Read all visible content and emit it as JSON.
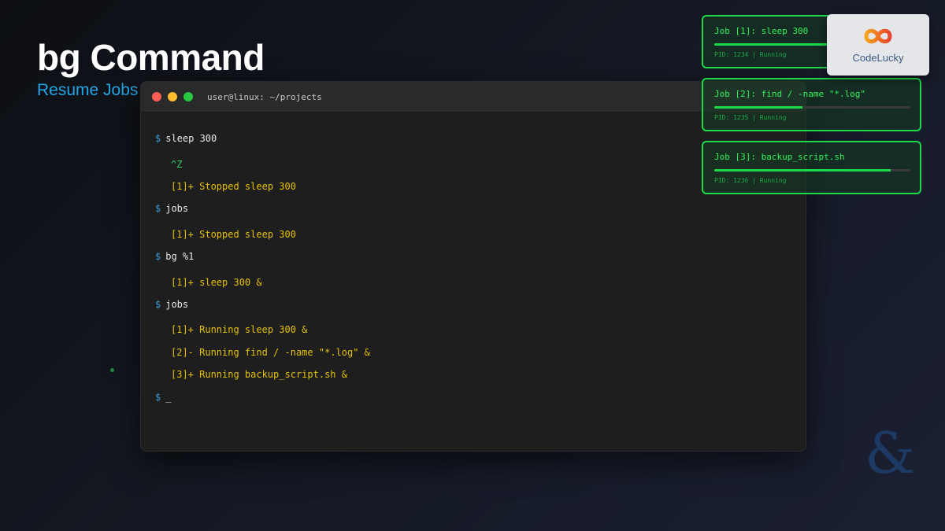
{
  "header": {
    "title": "bg Command",
    "subtitle": "Resume Jobs"
  },
  "terminal": {
    "window_title": "user@linux: ~/projects",
    "prompt_symbol": "$",
    "lines": [
      {
        "kind": "cmd",
        "text": "sleep 300"
      },
      {
        "kind": "ctrl",
        "text": "^Z"
      },
      {
        "kind": "out",
        "text": "[1]+ Stopped sleep 300"
      },
      {
        "kind": "cmd",
        "text": "jobs"
      },
      {
        "kind": "out",
        "text": "[1]+ Stopped sleep 300"
      },
      {
        "kind": "cmd",
        "text": "bg %1"
      },
      {
        "kind": "out",
        "text": "[1]+ sleep 300 &"
      },
      {
        "kind": "cmd",
        "text": "jobs"
      },
      {
        "kind": "out",
        "text": "[1]+ Running sleep 300 &"
      },
      {
        "kind": "out",
        "text": "[2]- Running find / -name \"*.log\" &"
      },
      {
        "kind": "out",
        "text": "[3]+ Running backup_script.sh &"
      },
      {
        "kind": "cmd",
        "text": "_"
      }
    ]
  },
  "jobs": [
    {
      "title": "Job [1]: sleep 300",
      "meta": "PID: 1234 | Running",
      "progress": 0.6
    },
    {
      "title": "Job [2]: find / -name \"*.log\"",
      "meta": "PID: 1235 | Running",
      "progress": 0.45
    },
    {
      "title": "Job [3]: backup_script.sh",
      "meta": "PID: 1236 | Running",
      "progress": 0.9
    }
  ],
  "logo": {
    "text": "CodeLucky",
    "icon": "infinity-logo-icon"
  },
  "decor": {
    "ampersand": "&"
  },
  "colors": {
    "accent_blue": "#1fa8e6",
    "job_green": "#1ed94a",
    "output_yellow": "#e5c100"
  }
}
